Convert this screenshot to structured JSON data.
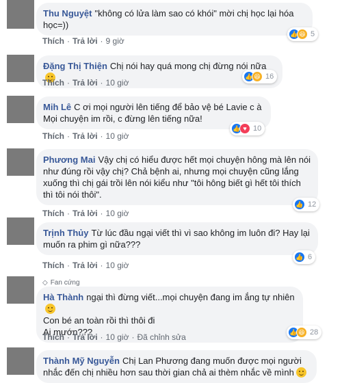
{
  "comments": [
    {
      "name": "Thu Nguyệt",
      "text": "\"không có lửa làm sao có khói\" mời chị học lại hóa học=))",
      "like": "Thích",
      "reply": "Trả lời",
      "time": "9 giờ",
      "reaction_count": "5"
    },
    {
      "name": "Đặng Thị Thiện",
      "text": "Chị nói hay quá mong chị đừng nói nữa",
      "like": "Thích",
      "reply": "Trả lời",
      "time": "10 giờ",
      "reaction_count": "16"
    },
    {
      "name": "Mih Lê",
      "text": "C ơi mọi người lên tiếng để bảo vệ bé Lavie c à Mọi chuyện im rồi, c đừng lên tiếng nữa!",
      "like": "Thích",
      "reply": "Trả lời",
      "time": "10 giờ",
      "reaction_count": "10"
    },
    {
      "name": "Phương Mai",
      "text": "Vậy chị có hiểu được hết mọi chuyện hông mà lên nói như đúng rồi vậy chị? Chả bệnh ai, nhưng mọi chuyện cũng lắng xuống thì chị gái trồi lên nói kiểu như \"tôi hông biết gì hết tôi thích thì tôi nói thôi\".",
      "like": "Thích",
      "reply": "Trả lời",
      "time": "10 giờ",
      "reaction_count": "12"
    },
    {
      "name": "Trịnh Thủy",
      "text": "Từ lúc đầu ngại viết thì vì sao không im luôn đi? Hay lại muốn ra phim gì nữa???",
      "like": "Thích",
      "reply": "Trả lời",
      "time": "10 giờ",
      "reaction_count": "6"
    },
    {
      "badge": "Fan cứng",
      "name": "Hà Thành",
      "text_lines": [
        "ngại thì đừng viết...mọi chuyện đang im ắng tự nhiên",
        "Con bé an toàn rồi thì thôi đi",
        "Ai mướn???"
      ],
      "like": "Thích",
      "reply": "Trả lời",
      "time": "10 giờ",
      "edited": "Đã chỉnh sửa",
      "reaction_count": "28"
    },
    {
      "name": "Thành Mỹ Nguyễn",
      "text": "Chị Lan Phương đang muốn được mọi người nhắc đến chị nhiều hơn sau thời gian chả ai thèm nhắc về mình"
    }
  ],
  "icons": {
    "like": "thumbs-up-icon",
    "haha": "laughing-face-icon",
    "love": "heart-icon",
    "emoji": "smiley-emoji-icon",
    "badge": "diamond-icon"
  },
  "colors": {
    "name": "#385898",
    "bubble": "#f2f3f5",
    "like": "#1877f2",
    "haha": "#f7b125"
  }
}
